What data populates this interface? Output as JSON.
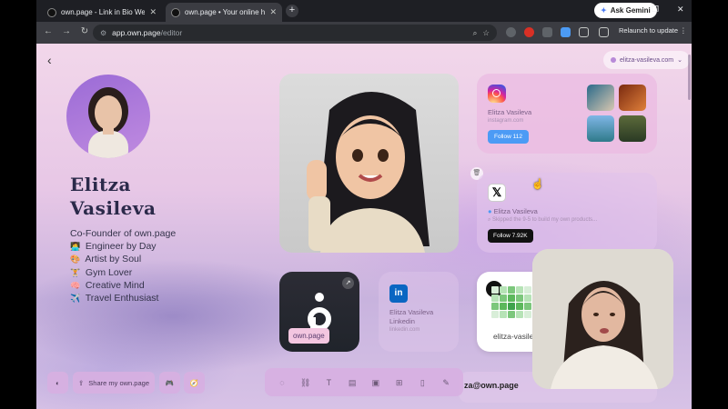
{
  "browser": {
    "tabs": [
      {
        "title": "own.page - Link in Bio Website",
        "active": false
      },
      {
        "title": "own.page • Your online home",
        "active": true
      }
    ],
    "new_tab": "+",
    "ask_gemini": "Ask Gemini",
    "controls": {
      "minimize": "–",
      "restore": "❐",
      "close": "✕"
    },
    "url_host": "app.own.page",
    "url_path": "/editor",
    "relaunch": "Relaunch to update"
  },
  "profile": {
    "name_line1": "Elitza",
    "name_line2": "Vasileva",
    "tagline": "Co-Founder of own.page",
    "bio": [
      {
        "emoji": "👩‍💻",
        "text": "Engineer by Day"
      },
      {
        "emoji": "🎨",
        "text": "Artist by Soul"
      },
      {
        "emoji": "🏋",
        "text": "Gym Lover"
      },
      {
        "emoji": "🧠",
        "text": "Creative Mind"
      },
      {
        "emoji": "✈️",
        "text": "Travel Enthusiast"
      }
    ]
  },
  "account_switcher": "elitza-vasileva.com",
  "instagram": {
    "name": "Elitza Vasileva",
    "site": "instagram.com",
    "follow": "Follow 112"
  },
  "twitter": {
    "name": "Elitza Vasileva",
    "bio": "Skipped the 9-5 to build my own products...",
    "follow": "Follow 7.92K"
  },
  "ownpage_widget": {
    "label": "own.page"
  },
  "linkedin": {
    "name": "Elitza Vasileva",
    "title": "Linkedin",
    "site": "linkedin.com"
  },
  "github": {
    "name": "elitza-vasileva"
  },
  "email": "za@own.page",
  "bottom": {
    "share": "Share my own.page"
  },
  "colors": {
    "accent": "#4c9bf5",
    "linkedin": "#0a66c2",
    "page_bg": "#e7c7e6"
  }
}
